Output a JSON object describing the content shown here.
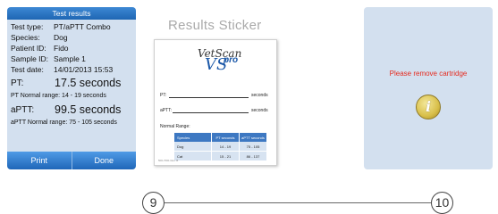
{
  "results_screen": {
    "title": "Test results",
    "fields": [
      {
        "label": "Test type:",
        "value": "PT/aPTT Combo"
      },
      {
        "label": "Species:",
        "value": "Dog"
      },
      {
        "label": "Patient ID:",
        "value": "Fido"
      },
      {
        "label": "Sample ID:",
        "value": "Sample 1"
      },
      {
        "label": "Test date:",
        "value": "14/01/2013 15:53"
      }
    ],
    "pt": {
      "label": "PT:",
      "value": "17.5 seconds"
    },
    "pt_range": "PT Normal range: 14 - 19 seconds",
    "aptt": {
      "label": "aPTT:",
      "value": "99.5 seconds"
    },
    "aptt_range": "aPTT Normal range: 75 - 105 seconds",
    "buttons": {
      "print": "Print",
      "done": "Done"
    }
  },
  "sticker": {
    "heading": "Results Sticker",
    "logo_top": "VetScan",
    "logo_vs": "VS",
    "logo_pro": "pro",
    "pt_label": "PT:",
    "pt_unit": "seconds",
    "aptt_label": "aPTT:",
    "aptt_unit": "seconds",
    "range_label": "Normal Range:",
    "table": {
      "headers": [
        "Species",
        "PT seconds",
        "aPTT seconds"
      ],
      "rows": [
        [
          "Dog",
          "14 - 19",
          "75 - 105"
        ],
        [
          "Cat",
          "15 - 21",
          "86 - 137"
        ]
      ]
    },
    "footer": "500-7001 Rev. B"
  },
  "cartridge_screen": {
    "message": "Please remove cartridge",
    "icon": "info-icon"
  },
  "steps": {
    "left": "9",
    "right": "10"
  },
  "colors": {
    "accent_blue": "#1e66b3",
    "screen_bg": "#d3e0ef",
    "warning_red": "#e52a1e"
  }
}
